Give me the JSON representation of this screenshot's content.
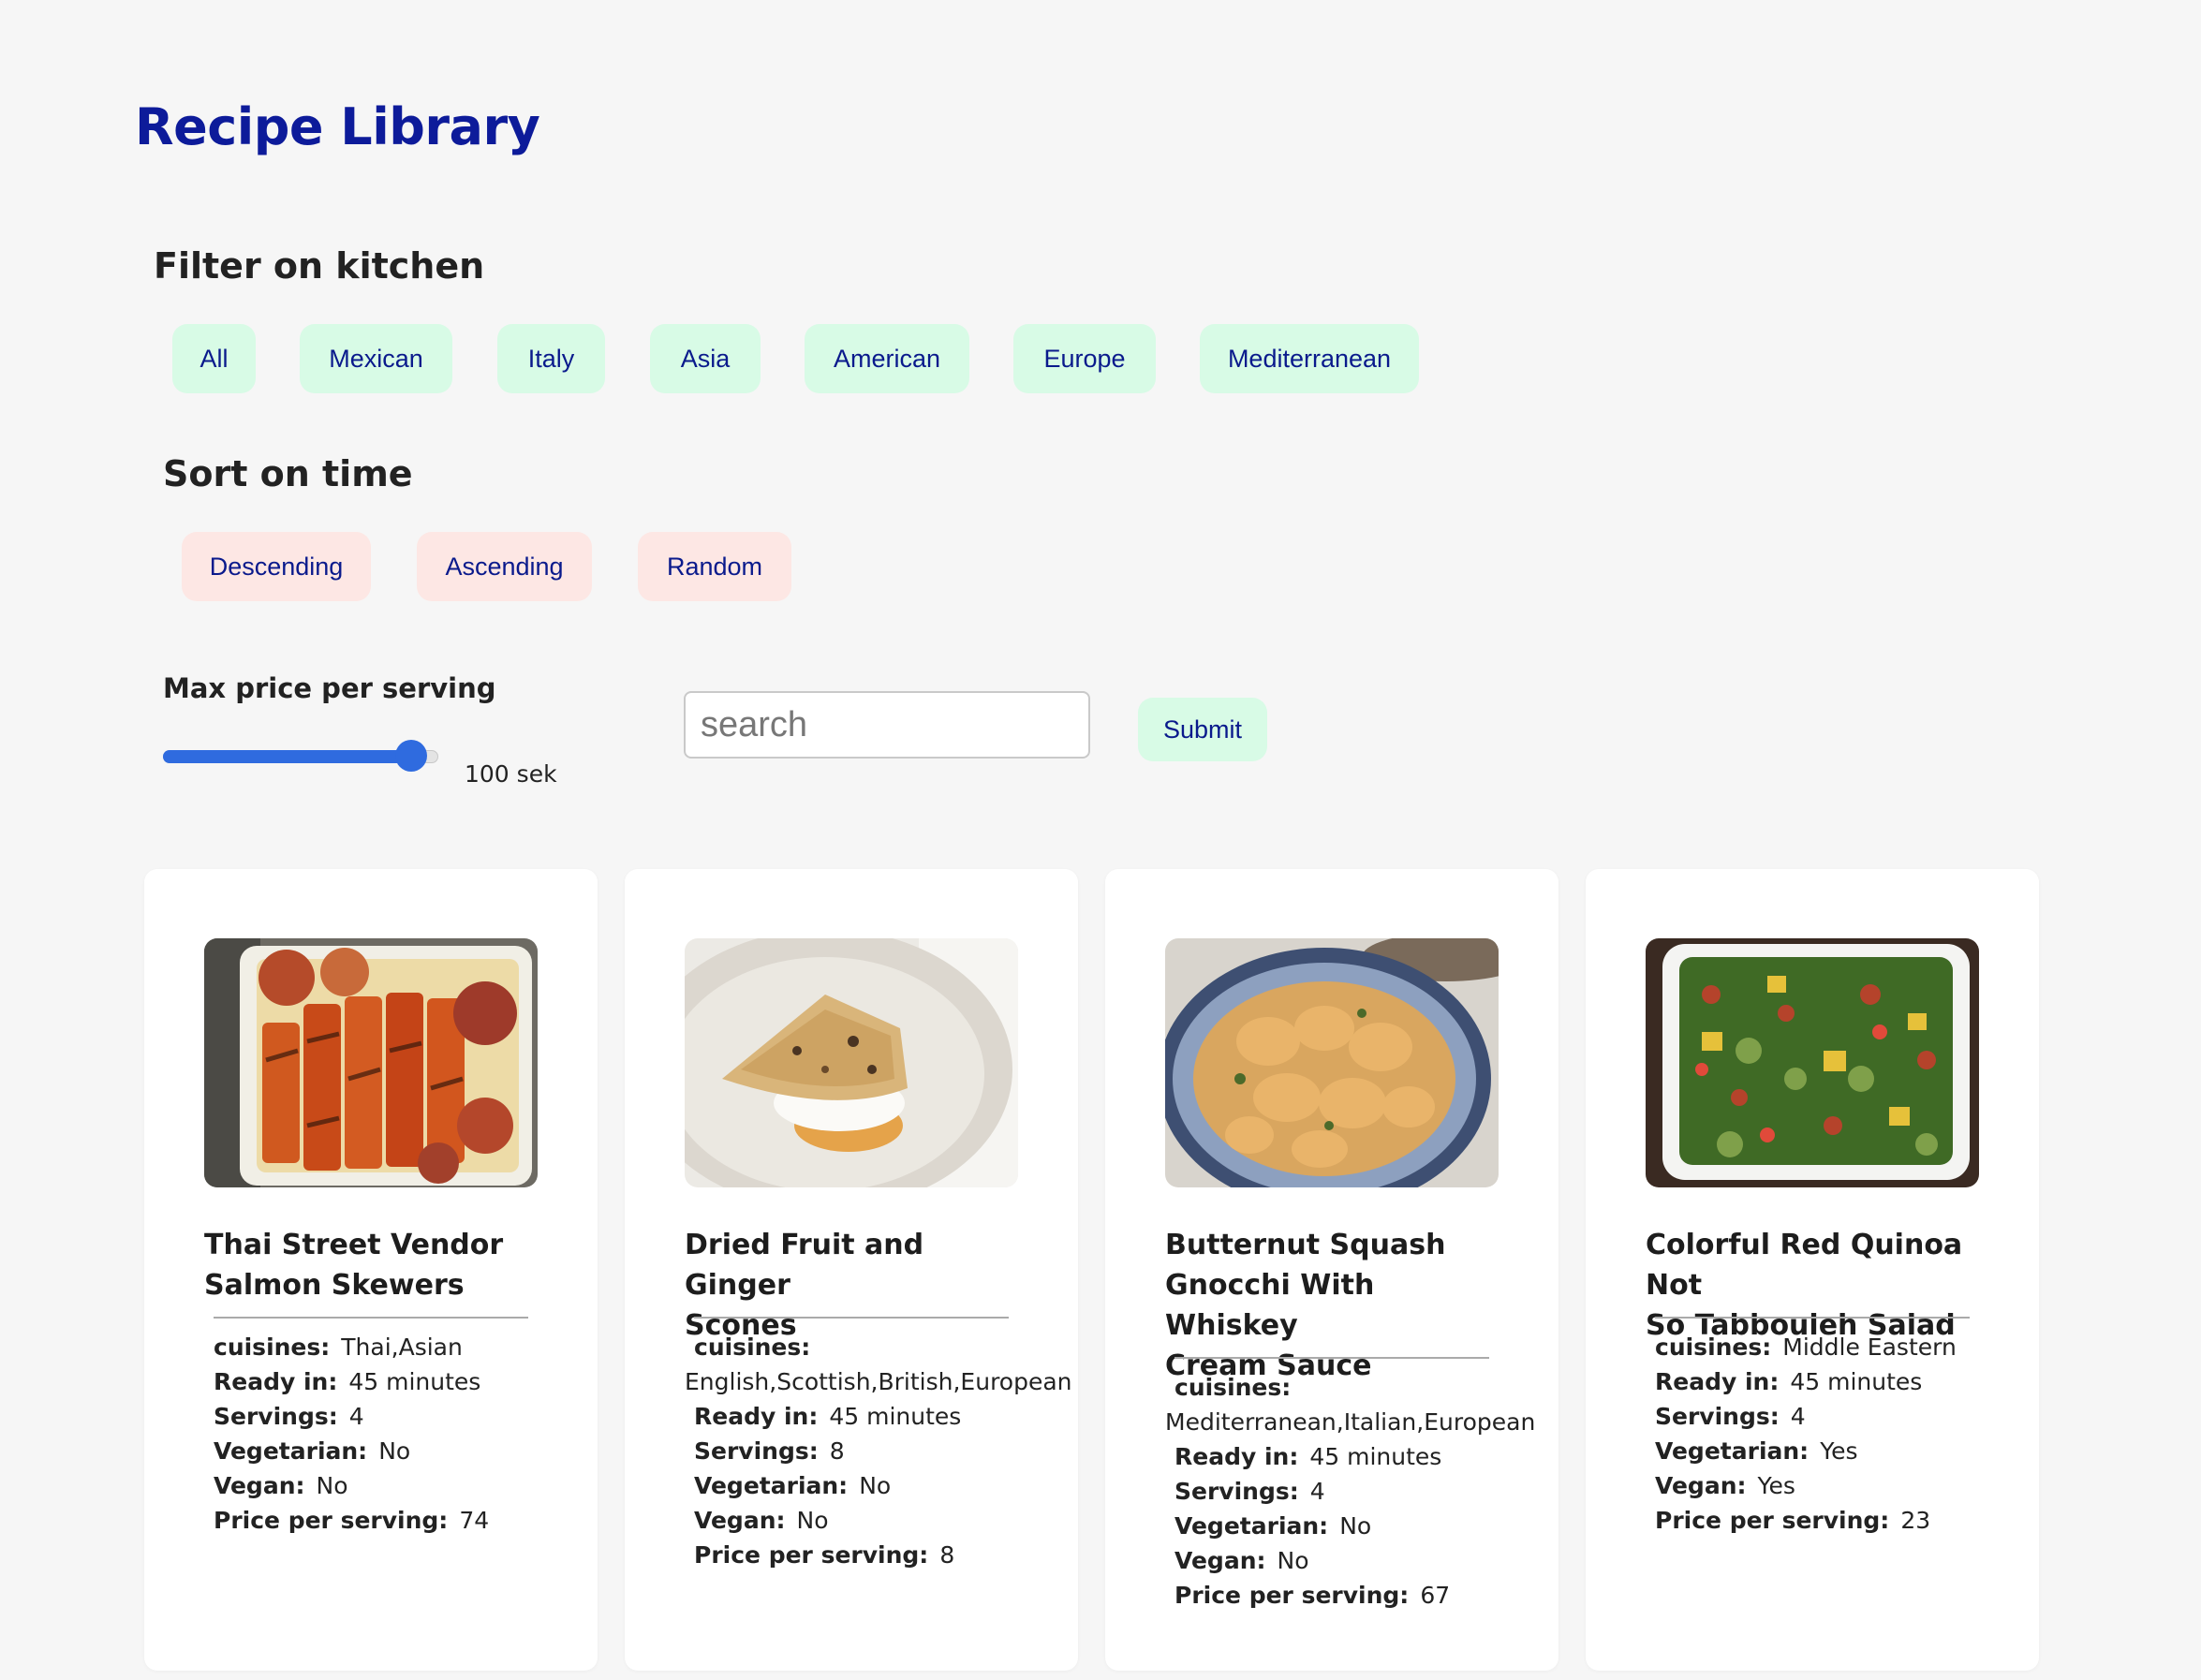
{
  "page": {
    "title": "Recipe Library"
  },
  "filter": {
    "heading": "Filter on kitchen",
    "options": [
      "All",
      "Mexican",
      "Italy",
      "Asia",
      "American",
      "Europe",
      "Mediterranean"
    ]
  },
  "sort": {
    "heading": "Sort on time",
    "options": [
      "Descending",
      "Ascending",
      "Random"
    ]
  },
  "price": {
    "heading": "Max price per serving",
    "slider_fraction": 0.9,
    "value_text": "100 sek"
  },
  "search": {
    "placeholder": "search",
    "value": "",
    "submit_label": "Submit"
  },
  "labels": {
    "cuisines": "cuisines:",
    "ready": "Ready in:",
    "servings": "Servings:",
    "vegetarian": "Vegetarian:",
    "vegan": "Vegan:",
    "price": "Price per serving:"
  },
  "recipes": [
    {
      "title_lines": [
        "Thai Street Vendor",
        "Salmon Skewers"
      ],
      "cuisines": "Thai,Asian",
      "ready": "45 minutes",
      "servings": "4",
      "vegetarian": "No",
      "vegan": "No",
      "price": "74",
      "photo": "salmon-skewers-photo"
    },
    {
      "title_lines": [
        "Dried Fruit and Ginger",
        "Scones"
      ],
      "cuisines": "English,Scottish,British,European",
      "ready": "45 minutes",
      "servings": "8",
      "vegetarian": "No",
      "vegan": "No",
      "price": "8",
      "photo": "scone-photo"
    },
    {
      "title_lines": [
        "Butternut Squash",
        "Gnocchi With Whiskey",
        "Cream Sauce"
      ],
      "cuisines": "Mediterranean,Italian,European",
      "ready": "45 minutes",
      "servings": "4",
      "vegetarian": "No",
      "vegan": "No",
      "price": "67",
      "photo": "gnocchi-photo"
    },
    {
      "title_lines": [
        "Colorful Red Quinoa Not",
        "So Tabbouleh Salad"
      ],
      "cuisines": "Middle Eastern",
      "ready": "45 minutes",
      "servings": "4",
      "vegetarian": "Yes",
      "vegan": "Yes",
      "price": "23",
      "photo": "quinoa-salad-photo"
    }
  ]
}
